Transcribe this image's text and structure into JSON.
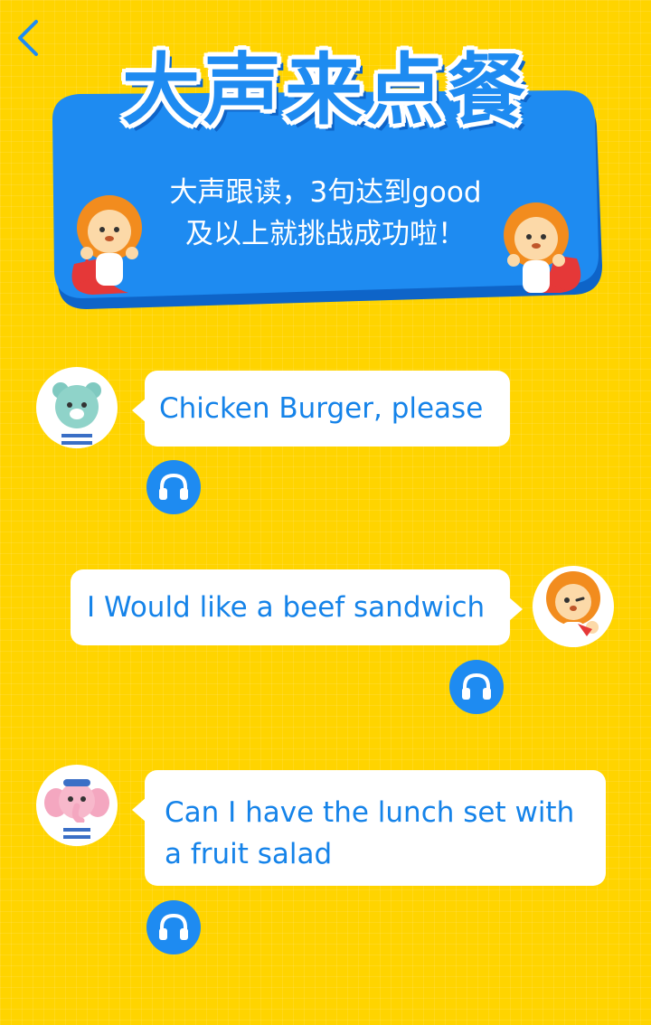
{
  "header": {
    "title": "大声来点餐",
    "subtitle_line1": "大声跟读，3句达到good",
    "subtitle_line2": "及以上就挑战成功啦！"
  },
  "colors": {
    "background": "#FFD400",
    "banner": "#1E8BF1",
    "banner_shadow": "#0E64C8",
    "text_blue": "#1583E9",
    "button": "#1E8BF1"
  },
  "dialogue": [
    {
      "speaker": "bear",
      "side": "left",
      "text": "Chicken  Burger, please"
    },
    {
      "speaker": "lion",
      "side": "right",
      "text": "I Would like a beef sandwich"
    },
    {
      "speaker": "elephant",
      "side": "left",
      "text_line1": "Can I have the lunch set with",
      "text_line2": "a fruit salad"
    }
  ],
  "icons": {
    "back": "chevron-left-icon",
    "play": "headphones-icon"
  }
}
